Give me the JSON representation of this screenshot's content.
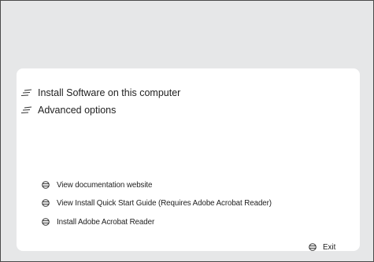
{
  "main_options": [
    {
      "label": "Install Software  on this computer",
      "icon": "lines-icon"
    },
    {
      "label": "Advanced options",
      "icon": "lines-icon"
    }
  ],
  "links": [
    {
      "label": "View documentation website",
      "icon": "globe-icon"
    },
    {
      "label": "View Install Quick Start Guide (Requires Adobe Acrobat Reader)",
      "icon": "globe-icon"
    },
    {
      "label": "Install Adobe Acrobat Reader",
      "icon": "globe-icon"
    }
  ],
  "exit": {
    "label": "Exit",
    "icon": "globe-icon"
  },
  "colors": {
    "background": "#e6e7e8",
    "panel": "#ffffff",
    "text": "#222222",
    "border": "#4a4a4a"
  }
}
